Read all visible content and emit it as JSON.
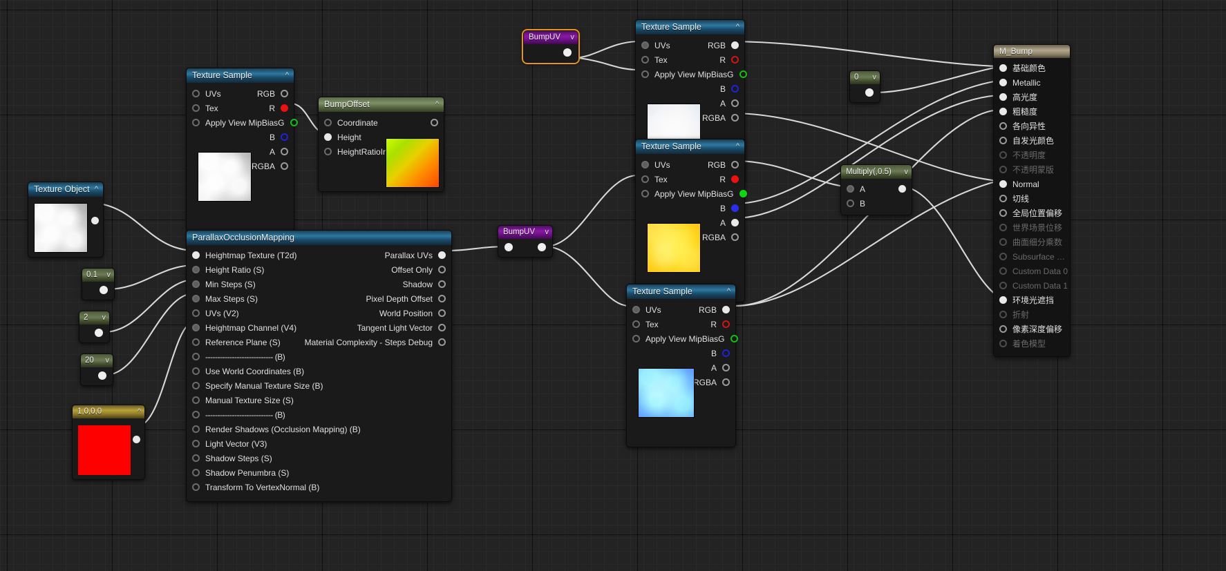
{
  "editor": {
    "name": "unreal-material-graph",
    "background": "#232323"
  },
  "nodes": {
    "texture_object": {
      "title": "Texture Object",
      "caret": "^",
      "outputs": [
        ""
      ]
    },
    "texture_sample_height": {
      "title": "Texture Sample",
      "caret": "^",
      "inputs": [
        "UVs",
        "Tex",
        "Apply View MipBias"
      ],
      "outputs": [
        "RGB",
        "R",
        "G",
        "B",
        "A",
        "RGBA"
      ]
    },
    "bump_offset": {
      "title": "BumpOffset",
      "caret": "^",
      "inputs": [
        "Coordinate",
        "Height",
        "HeightRatioInput"
      ]
    },
    "scalar_0_1": {
      "title": "0.1",
      "caret": "v"
    },
    "scalar_2": {
      "title": "2",
      "caret": "v"
    },
    "scalar_20": {
      "title": "20",
      "caret": "v"
    },
    "vector_1000": {
      "title": "1,0,0,0",
      "caret": "^",
      "color": "#ff0000"
    },
    "parallax": {
      "title": "ParallaxOcclusionMapping",
      "inputs": [
        "Heightmap Texture (T2d)",
        "Height Ratio (S)",
        "Min Steps (S)",
        "Max Steps (S)",
        "UVs (V2)",
        "Heightmap Channel (V4)",
        "Reference Plane (S)",
        "---------------------------- (B)",
        "Use World Coordinates (B)",
        "Specify Manual Texture Size (B)",
        "Manual Texture Size (S)",
        "---------------------------- (B)",
        "Render Shadows (Occlusion Mapping) (B)",
        "Light Vector (V3)",
        "Shadow Steps (S)",
        "Shadow Penumbra (S)",
        "Transform To VertexNormal (B)"
      ],
      "outputs": [
        "Parallax UVs",
        "Offset Only",
        "Shadow",
        "Pixel Depth Offset",
        "World Position",
        "Tangent Light Vector",
        "Material Complexity - Steps Debug"
      ]
    },
    "bumpuv_lower": {
      "title": "BumpUV",
      "caret": "v"
    },
    "bumpuv_upper": {
      "title": "BumpUV",
      "caret": "v"
    },
    "texture_sample_base": {
      "title": "Texture Sample",
      "caret": "^",
      "inputs": [
        "UVs",
        "Tex",
        "Apply View MipBias"
      ],
      "outputs": [
        "RGB",
        "R",
        "G",
        "B",
        "A",
        "RGBA"
      ]
    },
    "texture_sample_orange": {
      "title": "Texture Sample",
      "caret": "^",
      "inputs": [
        "UVs",
        "Tex",
        "Apply View MipBias"
      ],
      "outputs": [
        "RGB",
        "R",
        "G",
        "B",
        "A",
        "RGBA"
      ]
    },
    "texture_sample_normal": {
      "title": "Texture Sample",
      "caret": "^",
      "inputs": [
        "UVs",
        "Tex",
        "Apply View MipBias"
      ],
      "outputs": [
        "RGB",
        "R",
        "G",
        "B",
        "A",
        "RGBA"
      ]
    },
    "scalar_0": {
      "title": "0",
      "caret": "v"
    },
    "multiply": {
      "title": "Multiply(,0.5)",
      "caret": "v",
      "inputs": [
        "A",
        "B"
      ]
    },
    "material": {
      "title": "M_Bump",
      "pins": [
        {
          "label": "基础颜色",
          "connected": true,
          "enabled": true
        },
        {
          "label": "Metallic",
          "connected": true,
          "enabled": true
        },
        {
          "label": "高光度",
          "connected": true,
          "enabled": true
        },
        {
          "label": "粗糙度",
          "connected": true,
          "enabled": true
        },
        {
          "label": "各向异性",
          "connected": false,
          "enabled": true
        },
        {
          "label": "自发光颜色",
          "connected": false,
          "enabled": true
        },
        {
          "label": "不透明度",
          "connected": false,
          "enabled": false
        },
        {
          "label": "不透明蒙版",
          "connected": false,
          "enabled": false
        },
        {
          "label": "Normal",
          "connected": true,
          "enabled": true
        },
        {
          "label": "切线",
          "connected": false,
          "enabled": true
        },
        {
          "label": "全局位置偏移",
          "connected": false,
          "enabled": true
        },
        {
          "label": "世界场景位移",
          "connected": false,
          "enabled": false
        },
        {
          "label": "曲面细分乘数",
          "connected": false,
          "enabled": false
        },
        {
          "label": "Subsurface Color",
          "connected": false,
          "enabled": false
        },
        {
          "label": "Custom Data 0",
          "connected": false,
          "enabled": false
        },
        {
          "label": "Custom Data 1",
          "connected": false,
          "enabled": false
        },
        {
          "label": "环境光遮挡",
          "connected": true,
          "enabled": true
        },
        {
          "label": "折射",
          "connected": false,
          "enabled": false
        },
        {
          "label": "像素深度偏移",
          "connected": false,
          "enabled": true
        },
        {
          "label": "着色模型",
          "connected": false,
          "enabled": false
        }
      ]
    }
  }
}
